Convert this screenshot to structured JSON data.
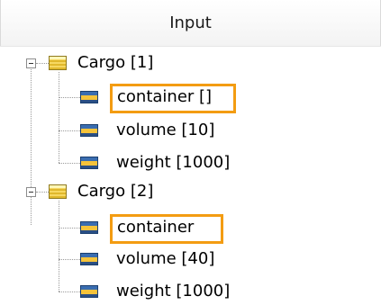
{
  "header": {
    "title": "Input"
  },
  "tree": {
    "groups": [
      {
        "label": "Cargo [1]",
        "children": [
          {
            "label": "container []",
            "highlighted": true
          },
          {
            "label": "volume [10]",
            "highlighted": false
          },
          {
            "label": "weight [1000]",
            "highlighted": false
          }
        ]
      },
      {
        "label": "Cargo [2]",
        "children": [
          {
            "label": "container",
            "highlighted": true
          },
          {
            "label": "volume [40]",
            "highlighted": false
          },
          {
            "label": "weight [1000]",
            "highlighted": false
          }
        ]
      }
    ]
  },
  "colors": {
    "highlight": "#f39c12",
    "attr_icon_blue": "#2a4f85",
    "attr_icon_yellow": "#f5c33a",
    "class_icon_yellow": "#e0b82d"
  },
  "icons": {
    "group": "class-icon",
    "child": "attribute-icon",
    "toggle": "collapse-minus-icon"
  }
}
